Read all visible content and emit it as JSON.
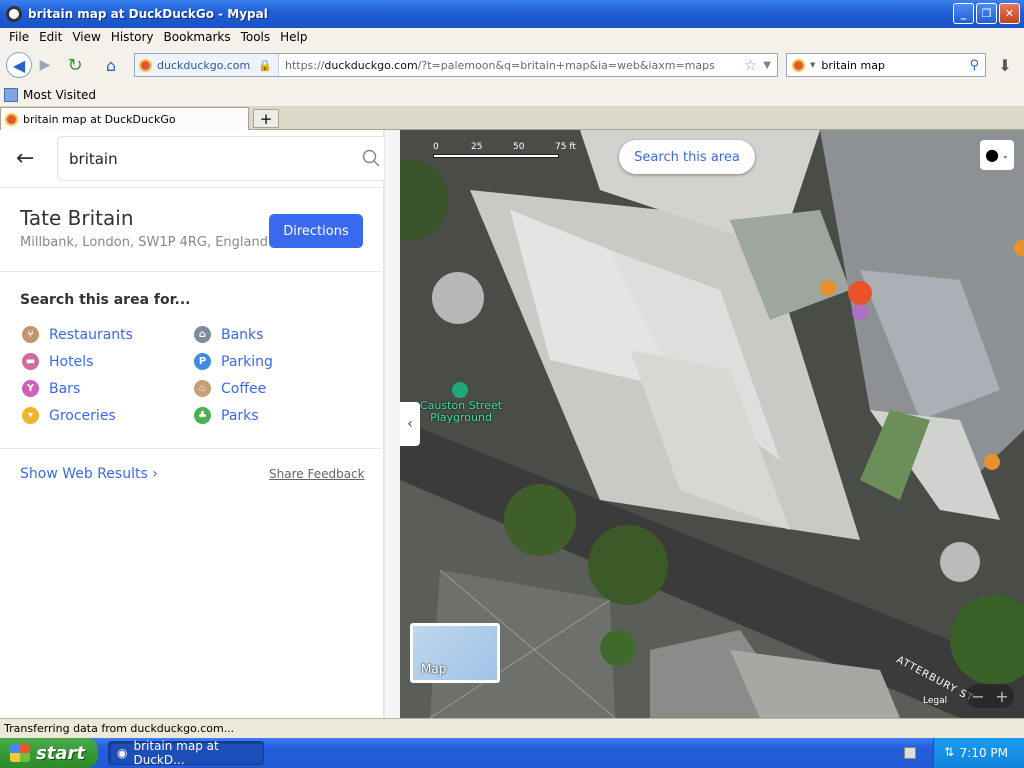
{
  "window": {
    "title": "britain map at DuckDuckGo - Mypal"
  },
  "menu": [
    "File",
    "Edit",
    "View",
    "History",
    "Bookmarks",
    "Tools",
    "Help"
  ],
  "nav": {
    "site_identity": "duckduckgo.com",
    "url_prefix": "https://",
    "url_host": "duckduckgo.com",
    "url_rest": "/?t=palemoon&q=britain+map&ia=web&iaxm=maps",
    "search_value": "britain map"
  },
  "bookmarks": {
    "most_visited": "Most Visited"
  },
  "tabs": [
    {
      "label": "britain map at DuckDuckGo"
    }
  ],
  "panel": {
    "search_value": "britain",
    "place_name": "Tate Britain",
    "place_address": "Millbank, London, SW1P 4RG, England",
    "directions_label": "Directions",
    "search_area_title": "Search this area for...",
    "categories": [
      {
        "label": "Restaurants",
        "icon": "fork-knife-icon",
        "color": "#c4956a"
      },
      {
        "label": "Banks",
        "icon": "bank-icon",
        "color": "#7d8b9c"
      },
      {
        "label": "Hotels",
        "icon": "bed-icon",
        "color": "#d26b9a"
      },
      {
        "label": "Parking",
        "icon": "parking-icon",
        "color": "#3f8de0"
      },
      {
        "label": "Bars",
        "icon": "cocktail-icon",
        "color": "#d05fb8"
      },
      {
        "label": "Coffee",
        "icon": "coffee-icon",
        "color": "#c6a075"
      },
      {
        "label": "Groceries",
        "icon": "basket-icon",
        "color": "#f0b429"
      },
      {
        "label": "Parks",
        "icon": "tree-icon",
        "color": "#4caf50"
      }
    ],
    "show_web_results": "Show Web Results",
    "share_feedback": "Share Feedback"
  },
  "map": {
    "scale_labels": [
      "0",
      "25",
      "50",
      "75 ft"
    ],
    "search_area_button": "Search this area",
    "playground_label_line1": "Causton Street",
    "playground_label_line2": "Playground",
    "street_label": "ATTERBURY ST",
    "map_thumb_label": "Map",
    "legal": "Legal"
  },
  "status": {
    "text": "Transferring data from duckduckgo.com..."
  },
  "taskbar": {
    "start": "start",
    "task_item": "britain map at DuckD...",
    "clock": "7:10 PM"
  },
  "colors": {
    "accent": "#3969ef",
    "xp_blue": "#245edb",
    "start_green": "#379b34"
  }
}
